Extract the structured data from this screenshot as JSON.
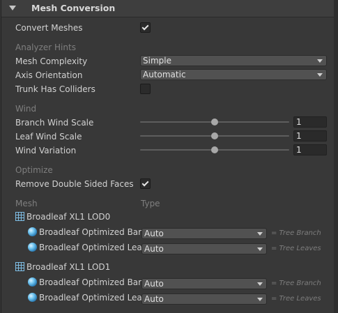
{
  "header": {
    "title": "Mesh Conversion"
  },
  "convert_meshes": {
    "label": "Convert Meshes",
    "checked": true
  },
  "analyzer": {
    "section": "Analyzer Hints",
    "mesh_complexity": {
      "label": "Mesh Complexity",
      "value": "Simple"
    },
    "axis_orientation": {
      "label": "Axis Orientation",
      "value": "Automatic"
    },
    "trunk_colliders": {
      "label": "Trunk Has Colliders",
      "checked": false
    }
  },
  "wind": {
    "section": "Wind",
    "branch": {
      "label": "Branch Wind Scale",
      "value": "1",
      "fraction": 0.5
    },
    "leaf": {
      "label": "Leaf Wind Scale",
      "value": "1",
      "fraction": 0.5
    },
    "variation": {
      "label": "Wind Variation",
      "value": "1",
      "fraction": 0.5
    }
  },
  "optimize": {
    "section": "Optimize",
    "remove_double": {
      "label": "Remove Double Sided Faces",
      "checked": true
    }
  },
  "mesh_table": {
    "col_mesh": "Mesh",
    "col_type": "Type",
    "groups": [
      {
        "name": "Broadleaf XL1 LOD0",
        "items": [
          {
            "name": "Broadleaf Optimized Bark",
            "type": "Auto",
            "hint": "= Tree Branch"
          },
          {
            "name": "Broadleaf Optimized Leaf",
            "type": "Auto",
            "hint": "= Tree Leaves"
          }
        ]
      },
      {
        "name": "Broadleaf XL1 LOD1",
        "items": [
          {
            "name": "Broadleaf Optimized Bark",
            "type": "Auto",
            "hint": "= Tree Branch"
          },
          {
            "name": "Broadleaf Optimized Leaf",
            "type": "Auto",
            "hint": "= Tree Leaves"
          }
        ]
      }
    ]
  }
}
